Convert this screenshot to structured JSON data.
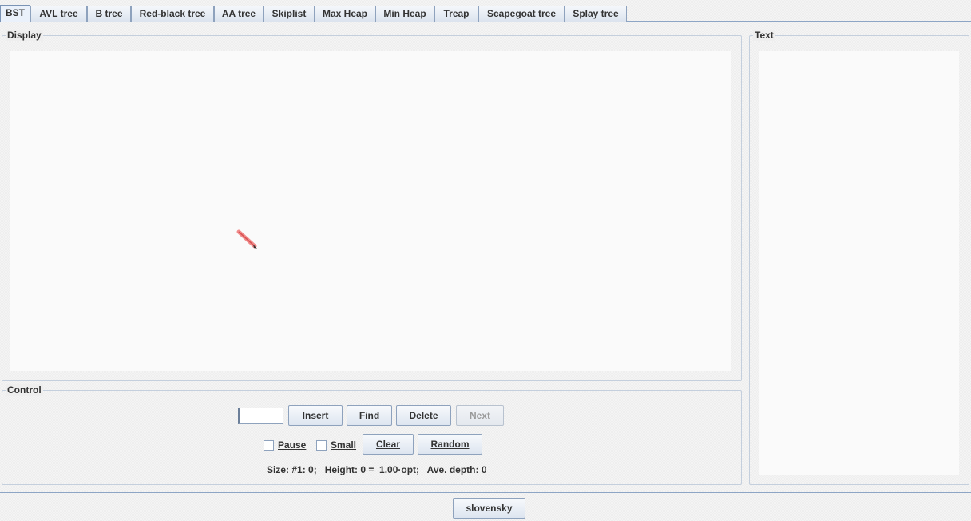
{
  "tabs": [
    {
      "label": "BST",
      "active": true
    },
    {
      "label": "AVL tree"
    },
    {
      "label": "B tree"
    },
    {
      "label": "Red-black tree"
    },
    {
      "label": "AA tree"
    },
    {
      "label": "Skiplist"
    },
    {
      "label": "Max Heap"
    },
    {
      "label": "Min Heap"
    },
    {
      "label": "Treap"
    },
    {
      "label": "Scapegoat tree"
    },
    {
      "label": "Splay tree"
    }
  ],
  "display": {
    "title": "Display"
  },
  "text_panel": {
    "title": "Text"
  },
  "control": {
    "title": "Control",
    "input_value": "",
    "buttons": {
      "insert": "Insert",
      "find": "Find",
      "delete": "Delete",
      "next": "Next",
      "clear": "Clear",
      "random": "Random"
    },
    "checkboxes": {
      "pause": {
        "label": "Pause",
        "checked": false
      },
      "small": {
        "label": "Small",
        "checked": false
      }
    },
    "stats": "Size: #1: 0;   Height: 0 =  1.00·opt;   Ave. depth: 0"
  },
  "footer": {
    "language_button": "slovensky"
  },
  "colors": {
    "accent_border": "#8ea2bd",
    "canvas_bg": "#fafafa"
  }
}
